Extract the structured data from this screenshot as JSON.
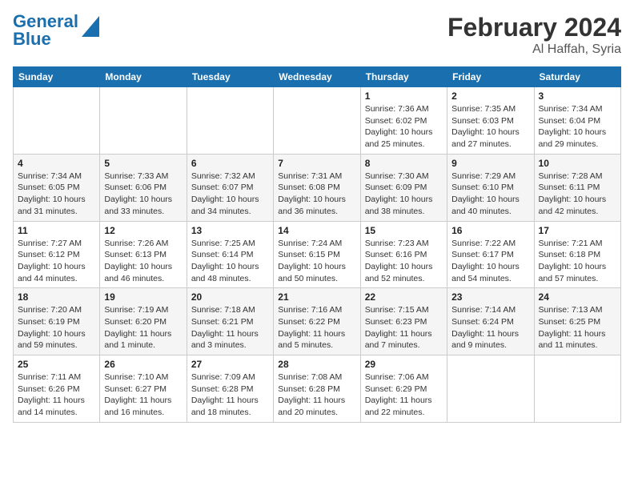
{
  "header": {
    "logo_line1": "General",
    "logo_line2": "Blue",
    "month_year": "February 2024",
    "location": "Al Haffah, Syria"
  },
  "calendar": {
    "days_of_week": [
      "Sunday",
      "Monday",
      "Tuesday",
      "Wednesday",
      "Thursday",
      "Friday",
      "Saturday"
    ],
    "weeks": [
      [
        {
          "day": "",
          "info": ""
        },
        {
          "day": "",
          "info": ""
        },
        {
          "day": "",
          "info": ""
        },
        {
          "day": "",
          "info": ""
        },
        {
          "day": "1",
          "info": "Sunrise: 7:36 AM\nSunset: 6:02 PM\nDaylight: 10 hours\nand 25 minutes."
        },
        {
          "day": "2",
          "info": "Sunrise: 7:35 AM\nSunset: 6:03 PM\nDaylight: 10 hours\nand 27 minutes."
        },
        {
          "day": "3",
          "info": "Sunrise: 7:34 AM\nSunset: 6:04 PM\nDaylight: 10 hours\nand 29 minutes."
        }
      ],
      [
        {
          "day": "4",
          "info": "Sunrise: 7:34 AM\nSunset: 6:05 PM\nDaylight: 10 hours\nand 31 minutes."
        },
        {
          "day": "5",
          "info": "Sunrise: 7:33 AM\nSunset: 6:06 PM\nDaylight: 10 hours\nand 33 minutes."
        },
        {
          "day": "6",
          "info": "Sunrise: 7:32 AM\nSunset: 6:07 PM\nDaylight: 10 hours\nand 34 minutes."
        },
        {
          "day": "7",
          "info": "Sunrise: 7:31 AM\nSunset: 6:08 PM\nDaylight: 10 hours\nand 36 minutes."
        },
        {
          "day": "8",
          "info": "Sunrise: 7:30 AM\nSunset: 6:09 PM\nDaylight: 10 hours\nand 38 minutes."
        },
        {
          "day": "9",
          "info": "Sunrise: 7:29 AM\nSunset: 6:10 PM\nDaylight: 10 hours\nand 40 minutes."
        },
        {
          "day": "10",
          "info": "Sunrise: 7:28 AM\nSunset: 6:11 PM\nDaylight: 10 hours\nand 42 minutes."
        }
      ],
      [
        {
          "day": "11",
          "info": "Sunrise: 7:27 AM\nSunset: 6:12 PM\nDaylight: 10 hours\nand 44 minutes."
        },
        {
          "day": "12",
          "info": "Sunrise: 7:26 AM\nSunset: 6:13 PM\nDaylight: 10 hours\nand 46 minutes."
        },
        {
          "day": "13",
          "info": "Sunrise: 7:25 AM\nSunset: 6:14 PM\nDaylight: 10 hours\nand 48 minutes."
        },
        {
          "day": "14",
          "info": "Sunrise: 7:24 AM\nSunset: 6:15 PM\nDaylight: 10 hours\nand 50 minutes."
        },
        {
          "day": "15",
          "info": "Sunrise: 7:23 AM\nSunset: 6:16 PM\nDaylight: 10 hours\nand 52 minutes."
        },
        {
          "day": "16",
          "info": "Sunrise: 7:22 AM\nSunset: 6:17 PM\nDaylight: 10 hours\nand 54 minutes."
        },
        {
          "day": "17",
          "info": "Sunrise: 7:21 AM\nSunset: 6:18 PM\nDaylight: 10 hours\nand 57 minutes."
        }
      ],
      [
        {
          "day": "18",
          "info": "Sunrise: 7:20 AM\nSunset: 6:19 PM\nDaylight: 10 hours\nand 59 minutes."
        },
        {
          "day": "19",
          "info": "Sunrise: 7:19 AM\nSunset: 6:20 PM\nDaylight: 11 hours\nand 1 minute."
        },
        {
          "day": "20",
          "info": "Sunrise: 7:18 AM\nSunset: 6:21 PM\nDaylight: 11 hours\nand 3 minutes."
        },
        {
          "day": "21",
          "info": "Sunrise: 7:16 AM\nSunset: 6:22 PM\nDaylight: 11 hours\nand 5 minutes."
        },
        {
          "day": "22",
          "info": "Sunrise: 7:15 AM\nSunset: 6:23 PM\nDaylight: 11 hours\nand 7 minutes."
        },
        {
          "day": "23",
          "info": "Sunrise: 7:14 AM\nSunset: 6:24 PM\nDaylight: 11 hours\nand 9 minutes."
        },
        {
          "day": "24",
          "info": "Sunrise: 7:13 AM\nSunset: 6:25 PM\nDaylight: 11 hours\nand 11 minutes."
        }
      ],
      [
        {
          "day": "25",
          "info": "Sunrise: 7:11 AM\nSunset: 6:26 PM\nDaylight: 11 hours\nand 14 minutes."
        },
        {
          "day": "26",
          "info": "Sunrise: 7:10 AM\nSunset: 6:27 PM\nDaylight: 11 hours\nand 16 minutes."
        },
        {
          "day": "27",
          "info": "Sunrise: 7:09 AM\nSunset: 6:28 PM\nDaylight: 11 hours\nand 18 minutes."
        },
        {
          "day": "28",
          "info": "Sunrise: 7:08 AM\nSunset: 6:28 PM\nDaylight: 11 hours\nand 20 minutes."
        },
        {
          "day": "29",
          "info": "Sunrise: 7:06 AM\nSunset: 6:29 PM\nDaylight: 11 hours\nand 22 minutes."
        },
        {
          "day": "",
          "info": ""
        },
        {
          "day": "",
          "info": ""
        }
      ]
    ]
  }
}
